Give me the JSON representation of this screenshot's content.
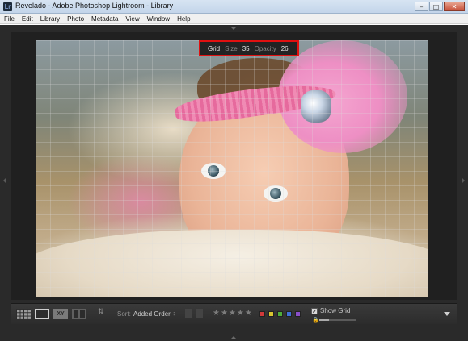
{
  "window": {
    "title": "Revelado - Adobe Photoshop Lightroom - Library",
    "app_icon": "Lr",
    "minimize": "–",
    "maximize": "□",
    "close": "✕"
  },
  "menu": [
    "File",
    "Edit",
    "Library",
    "Photo",
    "Metadata",
    "View",
    "Window",
    "Help"
  ],
  "grid_overlay": {
    "label": "Grid",
    "size_label": "Size",
    "size_value": "35",
    "opacity_label": "Opacity",
    "opacity_value": "26",
    "highlight_color": "#e01010"
  },
  "toolbar": {
    "compare_label": "XY",
    "sort_icon": "⇅",
    "sort_label": "Sort:",
    "sort_value": "Added Order ÷",
    "stars": "★★★★★",
    "color_labels": [
      "#d23a3a",
      "#d8c630",
      "#4fae3a",
      "#3f6fd8",
      "#8a4fc8"
    ],
    "show_grid_checked": "✓",
    "show_grid_label": "Show Grid",
    "lock_icon": "🔒",
    "grid_slider_level": 0.25
  },
  "icons": {
    "panel_toggles": "triangle-icon",
    "view_modes": [
      "grid-view-icon",
      "loupe-view-icon",
      "compare-view-icon",
      "survey-view-icon"
    ]
  }
}
